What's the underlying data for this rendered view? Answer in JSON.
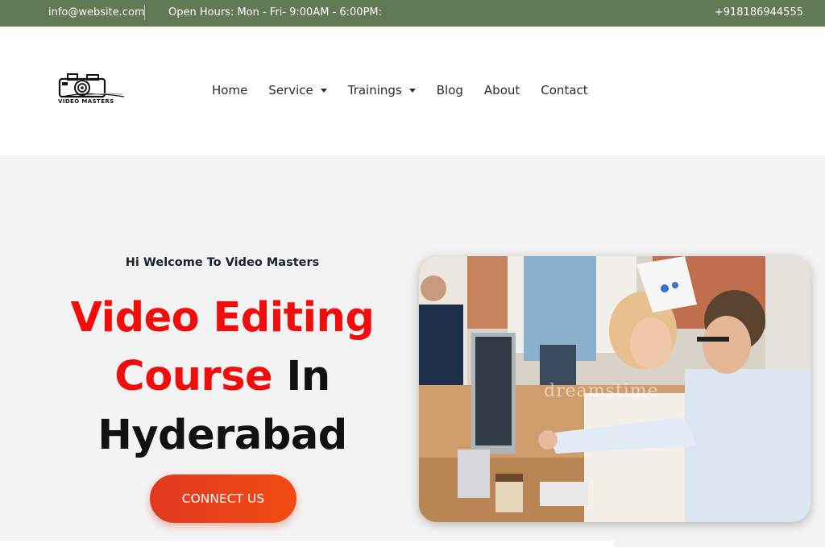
{
  "topbar": {
    "email": "info@website.com",
    "hours": "Open Hours: Mon - Fri- 9:00AM - 6:00PM:",
    "phone": "+918186944555",
    "bg_color": "#5f7a55"
  },
  "logo": {
    "text": "VIDEO MASTERS",
    "icon": "camera-logo-icon"
  },
  "nav": {
    "home": "Home",
    "service": "Service",
    "trainings": "Trainings",
    "blog": "Blog",
    "about": "About",
    "contact": "Contact"
  },
  "hero": {
    "welcome": "Hi Welcome To Video Masters",
    "title_red_1": "Video Editing",
    "title_red_2": "Course",
    "title_dark_1": "In",
    "title_dark_2": "Hyderabad",
    "cta": "CONNECT US",
    "image_watermark": "dreamstime",
    "accent_red": "#f20d0d",
    "cta_color": "#e8401a"
  }
}
